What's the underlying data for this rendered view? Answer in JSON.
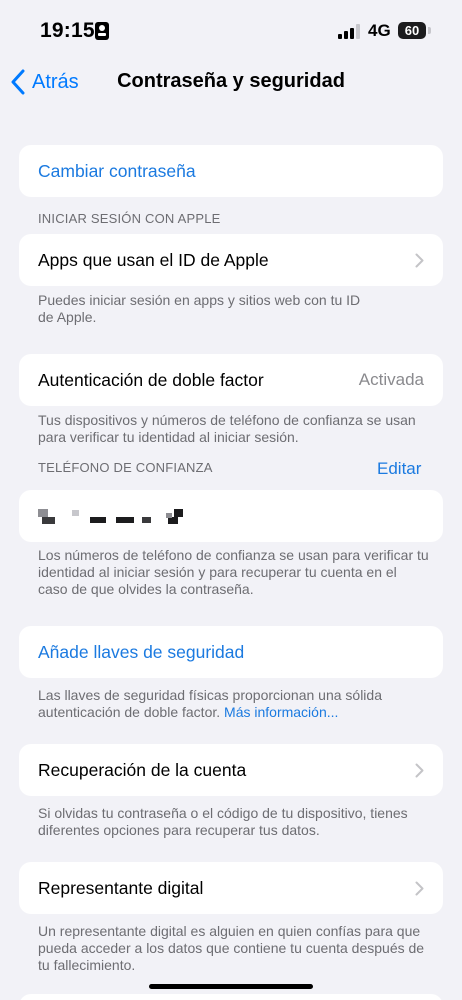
{
  "status": {
    "time": "19:15",
    "network": "4G",
    "battery": "60"
  },
  "nav": {
    "back_label": "Atrás",
    "title": "Contraseña y seguridad"
  },
  "change_password": {
    "label": "Cambiar contraseña"
  },
  "apple_signin": {
    "header": "INICIAR SESIÓN CON APPLE",
    "item_label": "Apps que usan el ID de Apple",
    "footnote": "Puedes iniciar sesión en apps y sitios web con tu ID de Apple."
  },
  "two_factor": {
    "label": "Autenticación de doble factor",
    "value": "Activada",
    "footnote": "Tus dispositivos y números de teléfono de confianza se usan para verificar tu identidad al iniciar sesión."
  },
  "trusted_phone": {
    "header": "TELÉFONO DE CONFIANZA",
    "edit_label": "Editar",
    "footnote": "Los números de teléfono de confianza se usan para verificar tu identidad al iniciar sesión y para recuperar tu cuenta en el caso de que olvides la contraseña."
  },
  "security_keys": {
    "label": "Añade llaves de seguridad",
    "footnote": "Las llaves de seguridad físicas proporcionan una sólida autenticación de doble factor.",
    "more_info": "Más información..."
  },
  "account_recovery": {
    "label": "Recuperación de la cuenta",
    "footnote": "Si olvidas tu contraseña o el código de tu dispositivo, tienes diferentes opciones para recuperar tus datos."
  },
  "legacy_contact": {
    "label": "Representante digital",
    "footnote": "Un representante digital es alguien en quien confías para que pueda acceder a los datos que contiene tu cuenta después de tu fallecimiento."
  },
  "colors": {
    "accent": "#007aff",
    "background": "#f2f2f7",
    "secondary_text": "#6d6d72"
  }
}
